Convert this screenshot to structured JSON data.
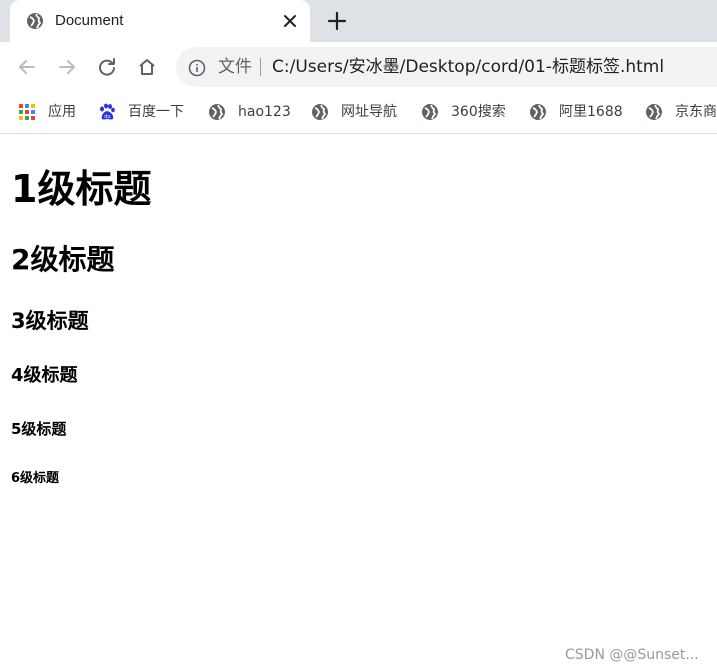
{
  "browser": {
    "tab": {
      "title": "Document"
    },
    "address_bar": {
      "scheme_label": "文件",
      "url": "C:/Users/安冰墨/Desktop/cord/01-标题标签.html"
    },
    "bookmarks": [
      {
        "label": "应用",
        "icon": "apps-grid-icon"
      },
      {
        "label": "百度一下",
        "icon": "baidu-paw-icon"
      },
      {
        "label": "hao123",
        "icon": "globe-icon"
      },
      {
        "label": "网址导航",
        "icon": "globe-icon"
      },
      {
        "label": "360搜索",
        "icon": "globe-icon"
      },
      {
        "label": "阿里1688",
        "icon": "globe-icon"
      },
      {
        "label": "京东商",
        "icon": "globe-icon"
      }
    ]
  },
  "page": {
    "headings": [
      "1级标题",
      "2级标题",
      "3级标题",
      "4级标题",
      "5级标题",
      "6级标题"
    ]
  },
  "watermark": "CSDN @@Sunset...",
  "colors": {
    "tabstrip": "#dee1e6",
    "omnibox": "#f1f3f4",
    "icon_gray": "#5f6368",
    "baidu_blue": "#2932e1"
  }
}
